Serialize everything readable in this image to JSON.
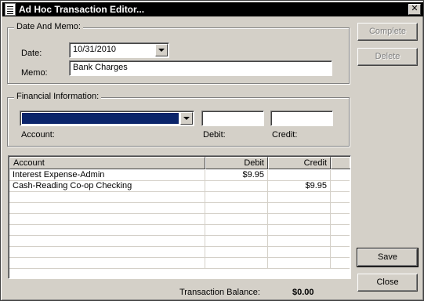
{
  "window": {
    "title": "Ad Hoc Transaction Editor...",
    "close_glyph": "✕",
    "title_icon": "document-icon"
  },
  "date_memo": {
    "group_label": "Date And Memo:",
    "date_label": "Date:",
    "date_value": "10/31/2010",
    "memo_label": "Memo:",
    "memo_value": "Bank Charges"
  },
  "financial": {
    "group_label": "Financial Information:",
    "account_label": "Account:",
    "account_value": "",
    "debit_label": "Debit:",
    "debit_value": "",
    "credit_label": "Credit:",
    "credit_value": ""
  },
  "buttons": {
    "complete": "Complete",
    "delete": "Delete",
    "save": "Save",
    "close": "Close"
  },
  "table": {
    "columns": [
      "Account",
      "Debit",
      "Credit"
    ],
    "rows": [
      {
        "account": "Interest Expense-Admin",
        "debit": "$9.95",
        "credit": ""
      },
      {
        "account": "Cash-Reading Co-op Checking",
        "debit": "",
        "credit": "$9.95"
      }
    ]
  },
  "balance": {
    "label": "Transaction Balance:",
    "value": "$0.00"
  },
  "colors": {
    "face": "#d4d0c8",
    "titlebar": "#000000",
    "selection": "#0a246a"
  }
}
